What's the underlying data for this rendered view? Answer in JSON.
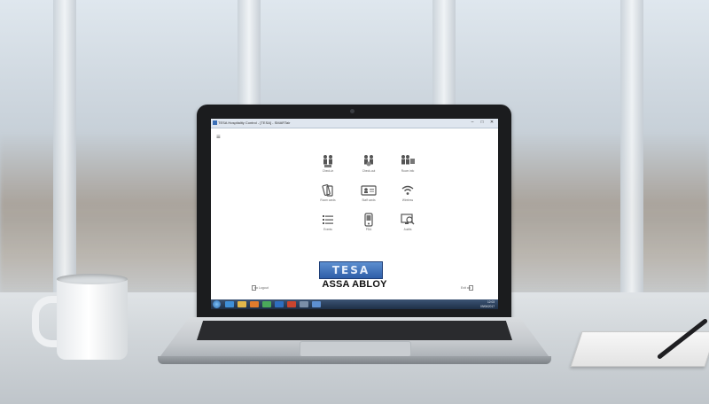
{
  "window": {
    "title": "TESA Hospitality Control - [TESA] - SMARTair",
    "min": "–",
    "max": "□",
    "close": "✕"
  },
  "menu_icon": "menu-icon",
  "tiles": [
    {
      "label": "Check-in",
      "icon": "check-in-icon"
    },
    {
      "label": "Check-out",
      "icon": "check-out-icon"
    },
    {
      "label": "Room info",
      "icon": "room-info-icon"
    },
    {
      "label": "Room cards",
      "icon": "room-cards-icon"
    },
    {
      "label": "Staff cards",
      "icon": "staff-cards-icon"
    },
    {
      "label": "Wireless",
      "icon": "wireless-icon"
    },
    {
      "label": "Events",
      "icon": "events-list-icon"
    },
    {
      "label": "PDA",
      "icon": "pda-icon"
    },
    {
      "label": "Audits",
      "icon": "audits-icon"
    }
  ],
  "logo": {
    "brand": "TESA",
    "company": "ASSA ABLOY"
  },
  "footer": {
    "logout": "Logout",
    "exit": "Exit"
  },
  "taskbar": {
    "time": "12:03",
    "date": "09/06/2017"
  },
  "colors": {
    "accent": "#2e5ea8",
    "taskbar": "#1e2f47"
  }
}
